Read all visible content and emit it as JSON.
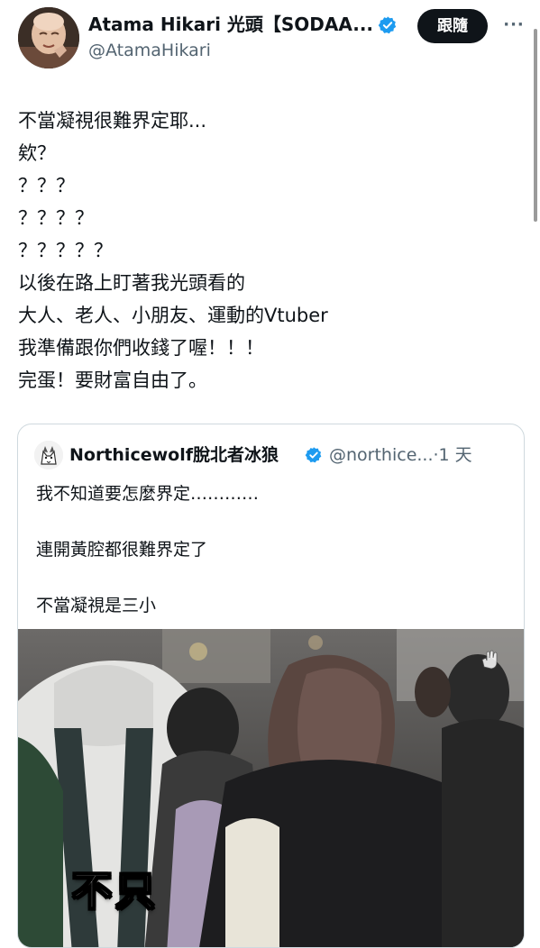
{
  "tweet": {
    "author": {
      "display_name": "Atama Hikari 光頭【SODAA...",
      "handle": "@AtamaHikari",
      "avatar_icon": "bald-character-avatar-icon",
      "verified_icon": "verified-badge-icon"
    },
    "follow_label": "跟隨",
    "more_icon_label": "···",
    "text_lines": [
      "不當凝視很難界定耶...",
      "欸？",
      "？？？",
      "？？？？",
      "？？？？？",
      "以後在路上盯著我光頭看的",
      "大人、老人、小朋友、運動的Vtuber",
      "我準備跟你們收錢了喔！！！",
      "完蛋！要財富自由了。"
    ]
  },
  "quote": {
    "author": {
      "display_name": "Northicewolf脫北者冰狼",
      "handle_time": "@northice...·1 天",
      "avatar_icon": "wolf-avatar-icon",
      "verified_icon": "verified-badge-icon"
    },
    "text_lines": [
      "我不知道要怎麼界定…………",
      "",
      "連開黃腔都很難界定了",
      "",
      "不當凝視是三小"
    ],
    "media": {
      "subtitle": "不只",
      "watermark_icon": "hand-watermark-icon"
    }
  },
  "colors": {
    "text": "#0f1419",
    "secondary": "#536471",
    "verified": "#1d9bf0",
    "border": "#cfd9de",
    "button_bg": "#0f1419"
  }
}
